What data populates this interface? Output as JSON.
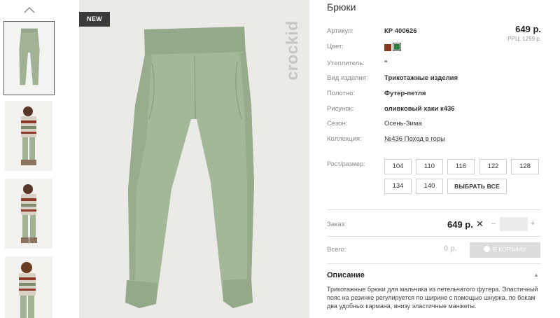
{
  "product": {
    "title": "Брюки",
    "badge": "NEW",
    "brand": "crockid",
    "price": "649 р.",
    "rrc": "РРЦ: 1299 р."
  },
  "attributes": [
    {
      "label": "Артикул:",
      "value": "КР 400626"
    },
    {
      "label": "Цвет:",
      "value": ""
    },
    {
      "label": "Утеплитель:",
      "value": "\""
    },
    {
      "label": "Вид изделия:",
      "value": "Трикотажные изделия"
    },
    {
      "label": "Полотно:",
      "value": "Футер-петля"
    },
    {
      "label": "Рисунок:",
      "value": "оливковый хаки к436"
    },
    {
      "label": "Сезон:",
      "value": "Осень-Зима"
    },
    {
      "label": "Коллекция:",
      "value": "№436 Поход в горы"
    }
  ],
  "colors": [
    "#8b3a22",
    "#2e7d3f"
  ],
  "sizes": {
    "label": "Рост/размер:",
    "options": [
      "104",
      "110",
      "116",
      "122",
      "128",
      "134",
      "140"
    ],
    "select_all": "ВЫБРАТЬ ВСЕ"
  },
  "order": {
    "label": "Заказ:",
    "price": "649 р.",
    "remove_glyph": "✕",
    "minus": "–",
    "plus": "+",
    "qty": ""
  },
  "total": {
    "label": "Всего:",
    "value": "0 р.",
    "cart_button": "В КОРЗИНУ"
  },
  "description": {
    "title": "Описание",
    "toggle": "▲",
    "text": "Трикотажные брюки для мальчика из петельчатого футера. Эластичный пояс на резинке регулируется по ширине с помощью шнурка, по бокам два удобных кармана, внизу эластичные манжеты."
  },
  "icons": {
    "thumb_up": "chevron-up-icon",
    "remove": "close-icon",
    "cart": "cart-icon"
  }
}
